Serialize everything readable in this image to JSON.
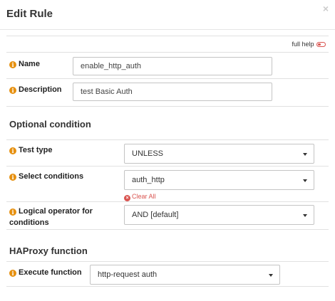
{
  "modal": {
    "title": "Edit Rule",
    "close_glyph": "×"
  },
  "help": {
    "label": "full help"
  },
  "fields": {
    "name": {
      "label": "Name",
      "value": "enable_http_auth"
    },
    "description": {
      "label": "Description",
      "value": "test Basic Auth"
    }
  },
  "optional_condition": {
    "title": "Optional condition",
    "test_type": {
      "label": "Test type",
      "selected": "UNLESS"
    },
    "select_conditions": {
      "label": "Select conditions",
      "selected": "auth_http",
      "clear_label": "Clear All"
    },
    "logical_operator": {
      "label_line1": "Logical operator for",
      "label_line2": "conditions",
      "selected": "AND [default]"
    }
  },
  "haproxy_function": {
    "title": "HAProxy function",
    "execute_function": {
      "label": "Execute function",
      "selected": "http-request auth"
    }
  },
  "icons": {
    "info": "info-icon",
    "close": "close-icon",
    "toggle": "toggle-icon",
    "caret": "chevron-down-icon",
    "clear": "clear-icon"
  },
  "colors": {
    "info": "#e6900f",
    "danger": "#d9534f",
    "border": "#e1e1e1"
  }
}
